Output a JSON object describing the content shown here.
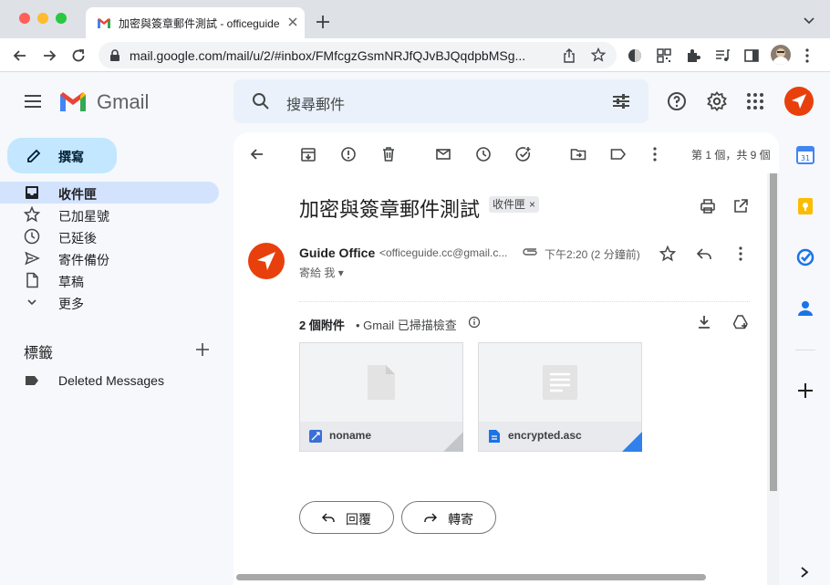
{
  "browser": {
    "tab_title": "加密與簽章郵件測試 - officeguide",
    "url": "mail.google.com/mail/u/2/#inbox/FMfcgzGsmNRJfQJvBJQqdpbMSg..."
  },
  "header": {
    "app_name": "Gmail",
    "search_placeholder": "搜尋郵件"
  },
  "sidebar": {
    "compose_label": "撰寫",
    "items": [
      {
        "label": "收件匣",
        "icon": "inbox-icon"
      },
      {
        "label": "已加星號",
        "icon": "star-icon"
      },
      {
        "label": "已延後",
        "icon": "clock-icon"
      },
      {
        "label": "寄件備份",
        "icon": "send-icon"
      },
      {
        "label": "草稿",
        "icon": "file-icon"
      },
      {
        "label": "更多",
        "icon": "chevron-down-icon"
      }
    ],
    "labels_heading": "標籤",
    "labels": [
      {
        "label": "Deleted Messages"
      }
    ]
  },
  "toolbar": {
    "pagination": "第 1 個，共 9 個"
  },
  "message": {
    "subject": "加密與簽章郵件測試",
    "chip_label": "收件匣",
    "sender_name": "Guide Office",
    "sender_email": "<officeguide.cc@gmail.c...",
    "time": "下午2:20 (2 分鐘前)",
    "to": "寄給 我",
    "attachments_count": "2 個附件",
    "scan_note": "• Gmail 已掃描檢查",
    "attachments": [
      {
        "name": "noname",
        "icon": "app-icon"
      },
      {
        "name": "encrypted.asc",
        "icon": "doc-icon"
      }
    ],
    "reply_label": "回覆",
    "forward_label": "轉寄"
  },
  "colors": {
    "accent": "#c2e7ff",
    "active_nav": "#d3e3fd",
    "avatar": "#e8400c"
  }
}
